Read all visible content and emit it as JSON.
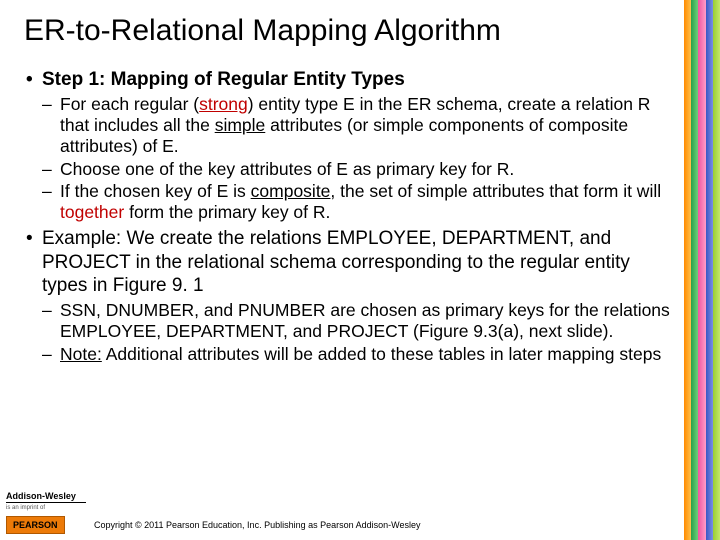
{
  "title": "ER-to-Relational Mapping Algorithm",
  "bullets": [
    {
      "label_before": "Step 1: Mapping of Regular Entity Types",
      "sub": [
        {
          "pre": "For each regular (",
          "u1": "strong",
          "mid1": ") entity type E in the ER schema, create a relation R that includes all the ",
          "u2": "simple",
          "post": " attributes (or simple components of composite attributes) of E."
        },
        {
          "text": "Choose one of the key attributes of E as primary key for R."
        },
        {
          "pre": "If the chosen key of E is ",
          "u1": "composite",
          "mid1": ", the set of simple attributes that form it will ",
          "red": "together",
          "post": " form the primary key of R."
        }
      ]
    },
    {
      "label_before": "Example: We create the relations EMPLOYEE, DEPARTMENT, and PROJECT in the relational schema corresponding to the regular entity types in Figure 9. 1",
      "sub": [
        {
          "text": "SSN, DNUMBER, and PNUMBER are chosen as primary keys for the relations EMPLOYEE, DEPARTMENT, and PROJECT (Figure 9.3(a), next slide)."
        },
        {
          "noteLabel": "Note:",
          "noteRest": " Additional attributes will be added to these tables in later mapping steps"
        }
      ]
    }
  ],
  "logo": {
    "aw": "Addison-Wesley",
    "aw_sub": "is an imprint of",
    "pearson": "PEARSON"
  },
  "copyright": "Copyright © 2011 Pearson Education, Inc. Publishing as Pearson Addison-Wesley"
}
